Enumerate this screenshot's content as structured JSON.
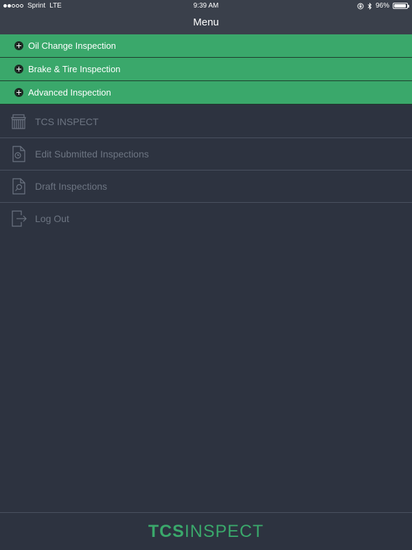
{
  "status_bar": {
    "carrier": "Sprint",
    "network": "LTE",
    "time": "9:39 AM",
    "battery": "96%",
    "battery_level": 0.96
  },
  "nav": {
    "title": "Menu"
  },
  "inspection_types": [
    {
      "label": "Oil Change Inspection"
    },
    {
      "label": "Brake & Tire Inspection"
    },
    {
      "label": "Advanced Inspection"
    }
  ],
  "menu": {
    "items": [
      {
        "label": "TCS INSPECT",
        "icon": "shop-icon"
      },
      {
        "label": "Edit Submitted Inspections",
        "icon": "clock-document-icon"
      },
      {
        "label": "Draft Inspections",
        "icon": "search-document-icon"
      },
      {
        "label": "Log Out",
        "icon": "logout-icon"
      }
    ]
  },
  "footer": {
    "logo_bold": "TCS",
    "logo_light": "INSPECT"
  },
  "colors": {
    "accent": "#3aa86b",
    "background": "#2d3340",
    "bar": "#3a404b",
    "muted_text": "#6d7582"
  }
}
